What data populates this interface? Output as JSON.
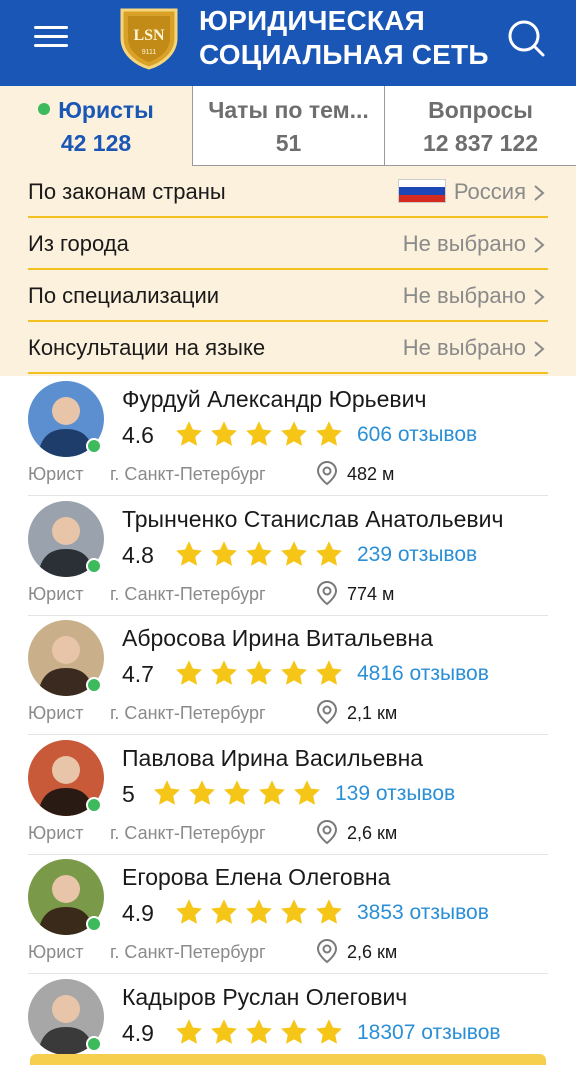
{
  "header": {
    "title_line1": "ЮРИДИЧЕСКАЯ",
    "title_line2": "СОЦИАЛЬНАЯ СЕТЬ",
    "logo_text": "LSN",
    "logo_subtext": "9111",
    "brand_color": "#1a56b6"
  },
  "tabs": [
    {
      "label": "Юристы",
      "count": "42 128",
      "active": true
    },
    {
      "label": "Чаты по тем...",
      "count": "51",
      "active": false
    },
    {
      "label": "Вопросы",
      "count": "12 837 122",
      "active": false
    }
  ],
  "filters": [
    {
      "label": "По законам страны",
      "value": "Россия",
      "icon": "russia-flag-icon"
    },
    {
      "label": "Из города",
      "value": "Не выбрано"
    },
    {
      "label": "По специализации",
      "value": "Не выбрано"
    },
    {
      "label": "Консультации на языке",
      "value": "Не выбрано"
    }
  ],
  "lawyers": [
    {
      "name": "Фурдуй Александр Юрьевич",
      "rating": "4.6",
      "stars": 5,
      "reviews": "606 отзывов",
      "role": "Юрист",
      "city": "г. Санкт-Петербург",
      "distance": "482 м",
      "online": true
    },
    {
      "name": "Трынченко Станислав Анатольевич",
      "rating": "4.8",
      "stars": 5,
      "reviews": "239 отзывов",
      "role": "Юрист",
      "city": "г. Санкт-Петербург",
      "distance": "774 м",
      "online": true
    },
    {
      "name": "Абросова Ирина Витальевна",
      "rating": "4.7",
      "stars": 5,
      "reviews": "4816 отзывов",
      "role": "Юрист",
      "city": "г. Санкт-Петербург",
      "distance": "2,1 км",
      "online": true
    },
    {
      "name": "Павлова Ирина Васильевна",
      "rating": "5",
      "stars": 5,
      "reviews": "139 отзывов",
      "role": "Юрист",
      "city": "г. Санкт-Петербург",
      "distance": "2,6 км",
      "online": true
    },
    {
      "name": "Егорова Елена Олеговна",
      "rating": "4.9",
      "stars": 5,
      "reviews": "3853 отзывов",
      "role": "Юрист",
      "city": "г. Санкт-Петербург",
      "distance": "2,6 км",
      "online": true
    },
    {
      "name": "Кадыров Руслан Олегович",
      "rating": "4.9",
      "stars": 5,
      "reviews": "18307 отзывов",
      "role": "",
      "city": "",
      "distance": "",
      "online": true
    }
  ],
  "colors": {
    "accent": "#1a56b6",
    "star": "#f5c518",
    "online": "#3dba5b",
    "review_link": "#2a8fd6",
    "filter_bg": "#fbf1dd",
    "filter_underline": "#f2c21c"
  }
}
